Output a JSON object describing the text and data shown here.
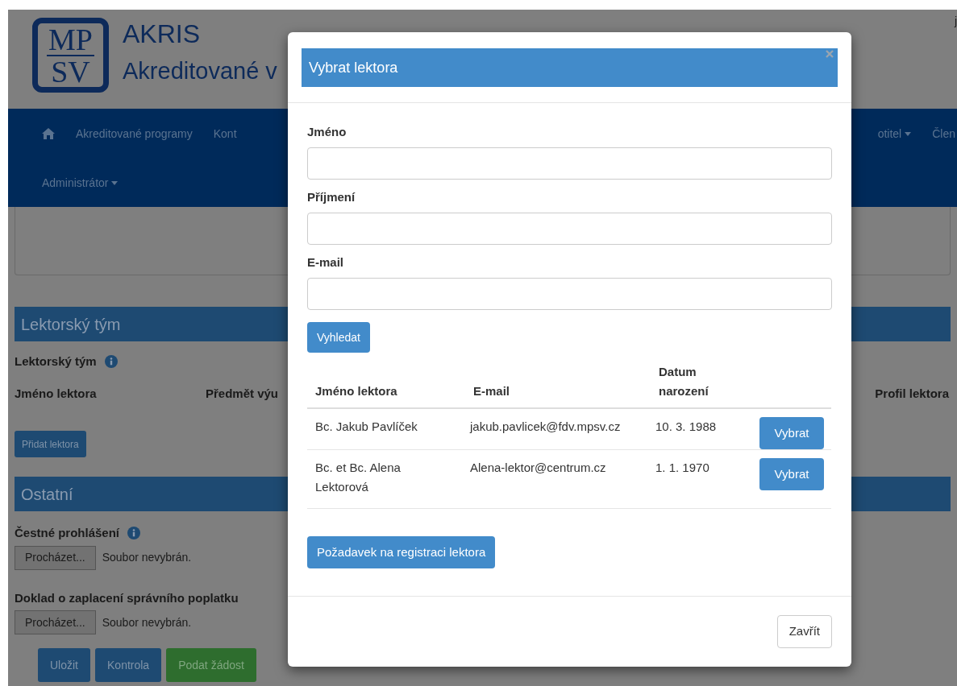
{
  "header": {
    "logo": [
      "MP",
      "SV"
    ],
    "title": "AKRIS",
    "subtitle": "Akreditované v",
    "user": "j"
  },
  "nav": {
    "left": [
      {
        "label": "Akreditované programy",
        "dropdown": false
      },
      {
        "label": "Kont",
        "dropdown": false
      }
    ],
    "right": [
      {
        "label": "otitel",
        "dropdown": true
      },
      {
        "label": "Člen",
        "dropdown": false
      }
    ],
    "second_row": [
      {
        "label": "Administrátor",
        "dropdown": true
      }
    ]
  },
  "lecturers": {
    "title": "Lektorský tým",
    "label": "Lektorský tým",
    "info": true,
    "columns": [
      "Jméno lektora",
      "Předmět výu",
      "Profil lektora"
    ],
    "add_button": "Přidat lektora"
  },
  "other": {
    "title": "Ostatní",
    "files": [
      {
        "label": "Čestné prohlášení",
        "info": true,
        "button": "Procházet...",
        "status": "Soubor nevybrán."
      },
      {
        "label": "Doklad o zaplacení správního poplatku",
        "info": false,
        "button": "Procházet...",
        "status": "Soubor nevybrán."
      }
    ]
  },
  "actions": [
    {
      "label": "Uložit",
      "kind": "primary"
    },
    {
      "label": "Kontrola",
      "kind": "primary"
    },
    {
      "label": "Podat žádost",
      "kind": "success"
    }
  ],
  "modal": {
    "title": "Vybrat lektora",
    "fields": [
      {
        "label": "Jméno"
      },
      {
        "label": "Příjmení"
      },
      {
        "label": "E-mail"
      }
    ],
    "search_button": "Vyhledat",
    "table": {
      "columns": [
        "Jméno lektora",
        "E-mail",
        "Datum narození"
      ],
      "rows": [
        {
          "name": "Bc. Jakub Pavlíček",
          "email": "jakub.pavlicek@fdv.mpsv.cz",
          "birth_date": "10. 3. 1988",
          "action": "Vybrat"
        },
        {
          "name": "Bc. et Bc. Alena Lektorová",
          "email": "Alena-lektor@centrum.cz",
          "birth_date": "1. 1. 1970",
          "action": "Vybrat"
        }
      ]
    },
    "register_button": "Požadavek na registraci lektora",
    "close_button": "Zavřít"
  }
}
